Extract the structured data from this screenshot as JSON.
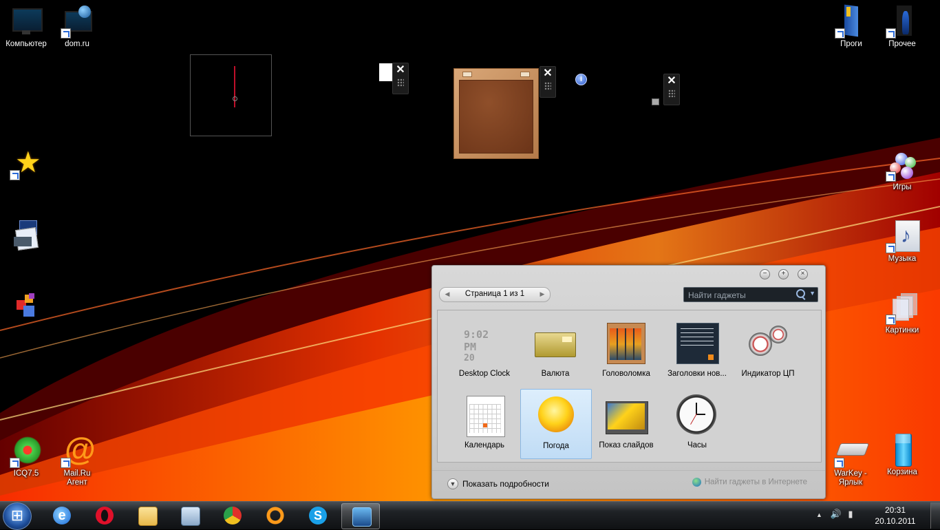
{
  "desktop": {
    "icons": [
      {
        "label": "Компьютер"
      },
      {
        "label": "dom.ru"
      },
      {
        "label": "Проги"
      },
      {
        "label": "Прочее"
      },
      {
        "label": "Игры"
      },
      {
        "label": "Музыка"
      },
      {
        "label": "Картинки"
      },
      {
        "label": "ICQ7.5"
      },
      {
        "label": "Mail.Ru Агент"
      },
      {
        "label": "WarKey - Ярлык"
      },
      {
        "label": "Корзина"
      }
    ],
    "unlabeled_icons": [
      "star-icon",
      "slide-show-icon",
      "cubes-icon"
    ],
    "close_glyph": "✕",
    "info_glyph": "i"
  },
  "gallery": {
    "pager_text": "Страница 1 из 1",
    "search_placeholder": "Найти гаджеты",
    "items": [
      {
        "label": "Desktop Clock",
        "icon": "desktop-clock-icon"
      },
      {
        "label": "Валюта",
        "icon": "currency-icon"
      },
      {
        "label": "Головоломка",
        "icon": "puzzle-icon"
      },
      {
        "label": "Заголовки нов...",
        "icon": "headlines-icon"
      },
      {
        "label": "Индикатор ЦП",
        "icon": "cpu-meter-icon"
      },
      {
        "label": "Календарь",
        "icon": "calendar-icon"
      },
      {
        "label": "Погода",
        "icon": "weather-icon",
        "selected": true
      },
      {
        "label": "Показ слайдов",
        "icon": "slideshow-icon"
      },
      {
        "label": "Часы",
        "icon": "clock-icon"
      }
    ],
    "desktop_clock_time": "9:02 PM",
    "desktop_clock_day": "20",
    "details_label": "Показать подробности",
    "online_label": "Найти гаджеты в Интернете"
  },
  "taskbar": {
    "pinned": [
      {
        "name": "internet-explorer"
      },
      {
        "name": "opera"
      },
      {
        "name": "explorer"
      },
      {
        "name": "control-panel"
      },
      {
        "name": "chrome"
      },
      {
        "name": "mail-ru-agent"
      },
      {
        "name": "skype"
      },
      {
        "name": "desktop-gadgets",
        "active": true
      }
    ],
    "time": "20:31",
    "date": "20.10.2011"
  },
  "colors": {
    "accent_red": "#c0102a",
    "wood": "#b57b4a",
    "selection": "#c0dcf5"
  }
}
